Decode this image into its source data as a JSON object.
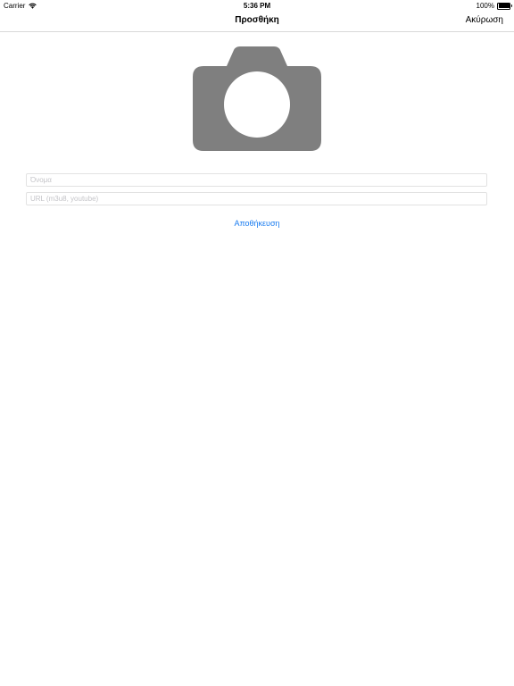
{
  "status_bar": {
    "carrier": "Carrier",
    "time": "5:36 PM",
    "battery": "100%",
    "wifi_icon": "wifi-icon",
    "battery_icon": "battery-icon"
  },
  "nav": {
    "title": "Προσθήκη",
    "cancel_label": "Ακύρωση"
  },
  "photo": {
    "icon": "camera-icon",
    "color": "#7f7f7f"
  },
  "form": {
    "name_placeholder": "Όνομα",
    "url_placeholder": "URL (m3u8, youtube)",
    "save_label": "Αποθήκευση"
  },
  "colors": {
    "accent": "#1a7cf0",
    "field_border": "#e2e2e2",
    "placeholder": "#c4c4c8"
  }
}
